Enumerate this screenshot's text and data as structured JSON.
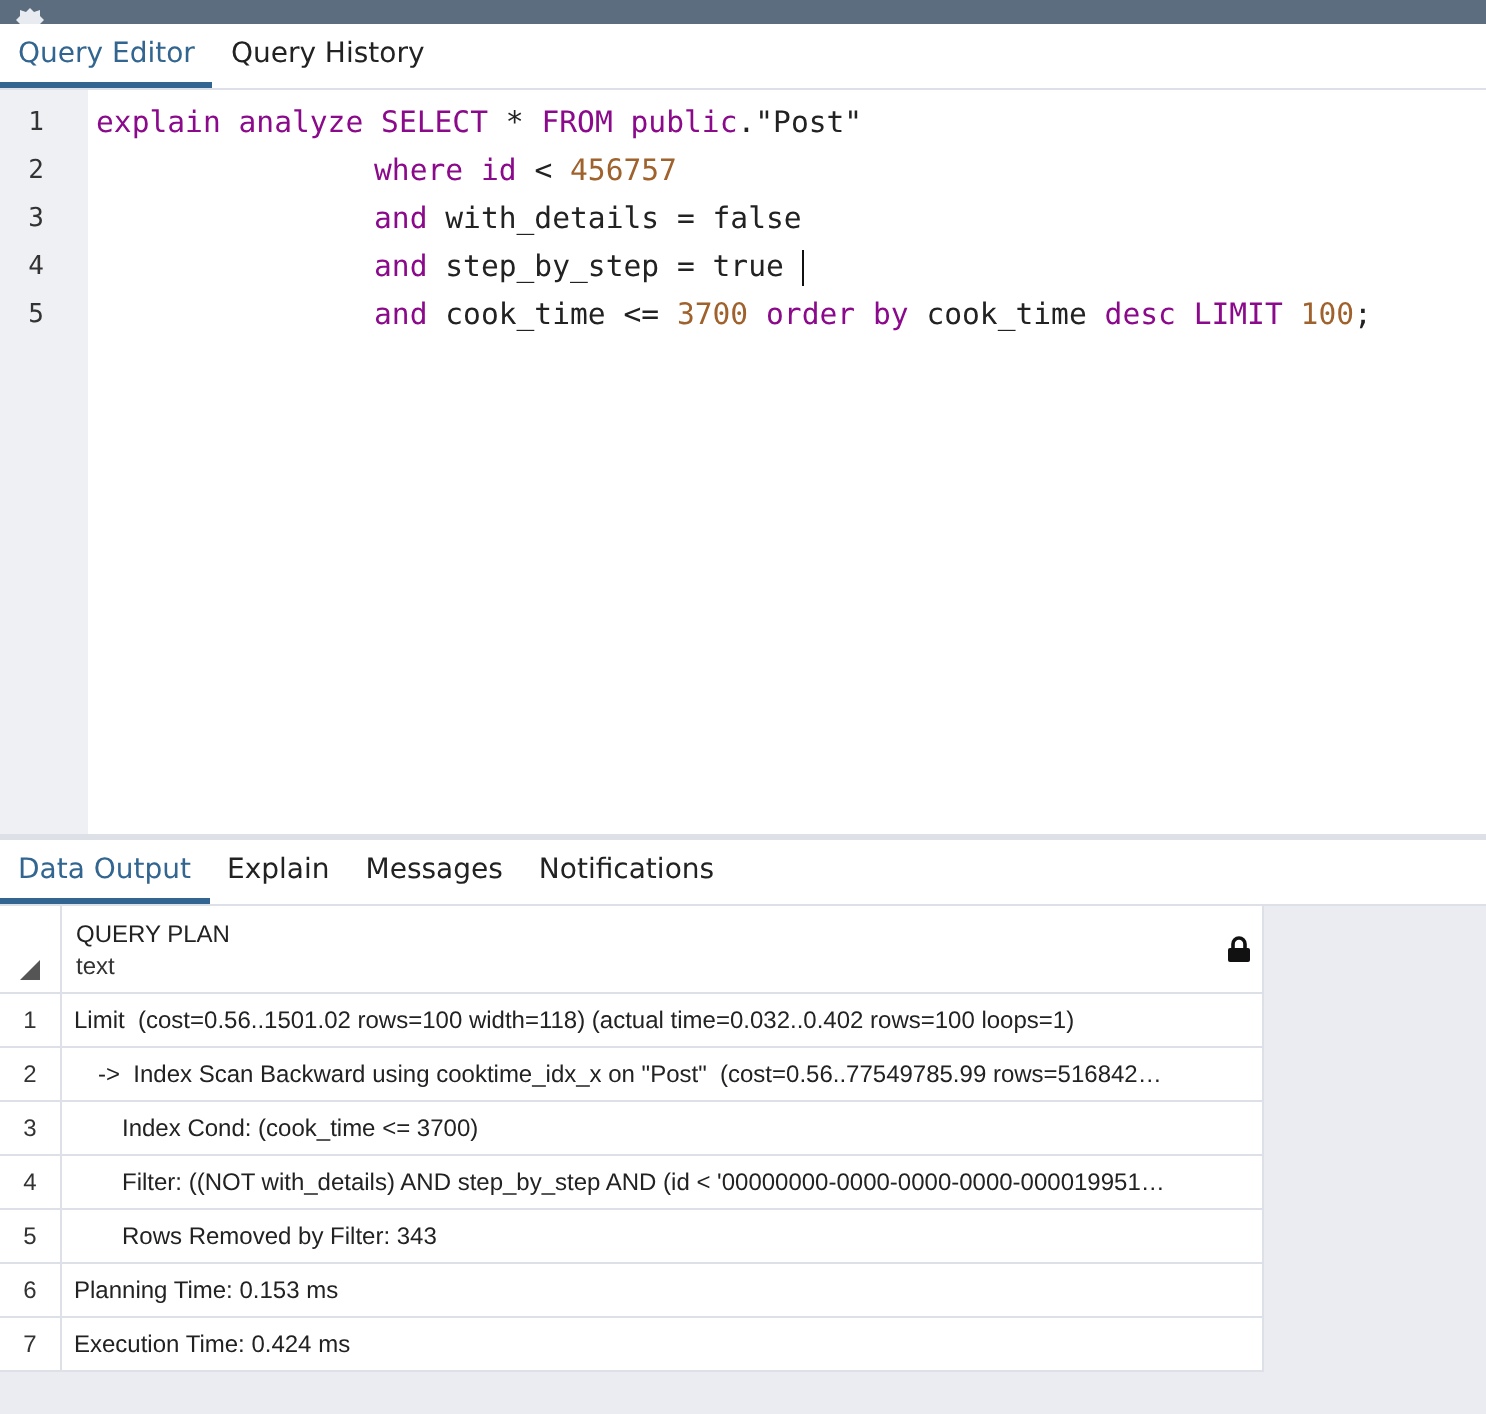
{
  "editor_tabs": [
    {
      "label": "Query Editor",
      "selected": true
    },
    {
      "label": "Query History",
      "selected": false
    }
  ],
  "code_lines": [
    {
      "number": "1",
      "indent": false,
      "cursor": false,
      "tokens": [
        {
          "kind": "keyword",
          "text": "explain analyze SELECT"
        },
        {
          "kind": "plain",
          "text": " * "
        },
        {
          "kind": "keyword",
          "text": "FROM public"
        },
        {
          "kind": "plain",
          "text": ".\"Post\""
        }
      ]
    },
    {
      "number": "2",
      "indent": true,
      "cursor": false,
      "tokens": [
        {
          "kind": "keyword",
          "text": "where id"
        },
        {
          "kind": "plain",
          "text": " < "
        },
        {
          "kind": "number",
          "text": "456757"
        }
      ]
    },
    {
      "number": "3",
      "indent": true,
      "cursor": false,
      "tokens": [
        {
          "kind": "keyword",
          "text": "and"
        },
        {
          "kind": "plain",
          "text": " with_details = false"
        }
      ]
    },
    {
      "number": "4",
      "indent": true,
      "cursor": true,
      "tokens": [
        {
          "kind": "keyword",
          "text": "and"
        },
        {
          "kind": "plain",
          "text": " step_by_step = true "
        }
      ]
    },
    {
      "number": "5",
      "indent": true,
      "cursor": false,
      "tokens": [
        {
          "kind": "keyword",
          "text": "and"
        },
        {
          "kind": "plain",
          "text": " cook_time <= "
        },
        {
          "kind": "number",
          "text": "3700"
        },
        {
          "kind": "keyword",
          "text": " order by"
        },
        {
          "kind": "plain",
          "text": " cook_time "
        },
        {
          "kind": "keyword",
          "text": "desc LIMIT"
        },
        {
          "kind": "number",
          "text": " 100"
        },
        {
          "kind": "plain",
          "text": ";"
        }
      ]
    }
  ],
  "output_tabs": [
    {
      "label": "Data Output",
      "selected": true
    },
    {
      "label": "Explain",
      "selected": false
    },
    {
      "label": "Messages",
      "selected": false
    },
    {
      "label": "Notifications",
      "selected": false
    }
  ],
  "table": {
    "column": {
      "name": "QUERY PLAN",
      "type": "text"
    },
    "rows": [
      {
        "number": "1",
        "text": "Limit  (cost=0.56..1501.02 rows=100 width=118) (actual time=0.032..0.402 rows=100 loops=1)",
        "children": [
          {
            "number": "2",
            "text": "->  Index Scan Backward using cooktime_idx_x on \"Post\"  (cost=0.56..77549785.99 rows=516842…",
            "children": [
              {
                "number": "3",
                "text": "Index Cond: (cook_time <= 3700)"
              },
              {
                "number": "4",
                "text": "Filter: ((NOT with_details) AND step_by_step AND (id < '00000000-0000-0000-0000-000019951…"
              },
              {
                "number": "5",
                "text": "Rows Removed by Filter: 343"
              }
            ]
          }
        ]
      },
      {
        "number": "6",
        "text": "Planning Time: 0.153 ms"
      },
      {
        "number": "7",
        "text": "Execution Time: 0.424 ms"
      }
    ]
  }
}
